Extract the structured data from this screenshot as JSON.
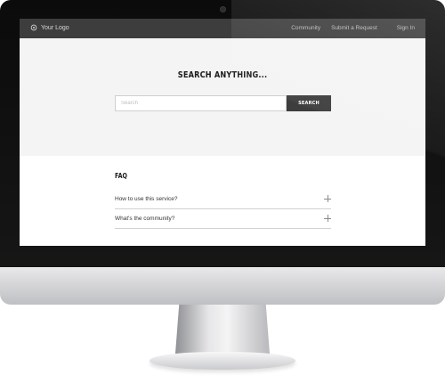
{
  "header": {
    "logo": "Your Logo",
    "nav": {
      "community": "Community",
      "submit_request": "Submit a Request",
      "sign_in": "Sign In"
    }
  },
  "hero": {
    "title": "SEARCH ANYTHING...",
    "search": {
      "placeholder": "Search",
      "value": "",
      "button": "SEARCH"
    }
  },
  "faq": {
    "title": "FAQ",
    "items": [
      {
        "question": "How to use this service?",
        "icon": "plus-icon"
      },
      {
        "question": "What's the community?",
        "icon": "plus-icon"
      }
    ]
  },
  "colors": {
    "navbar_bg": "#3d3d3d",
    "hero_bg": "#f4f4f4",
    "button_bg": "#3d3d3d",
    "bezel": "#111111"
  }
}
